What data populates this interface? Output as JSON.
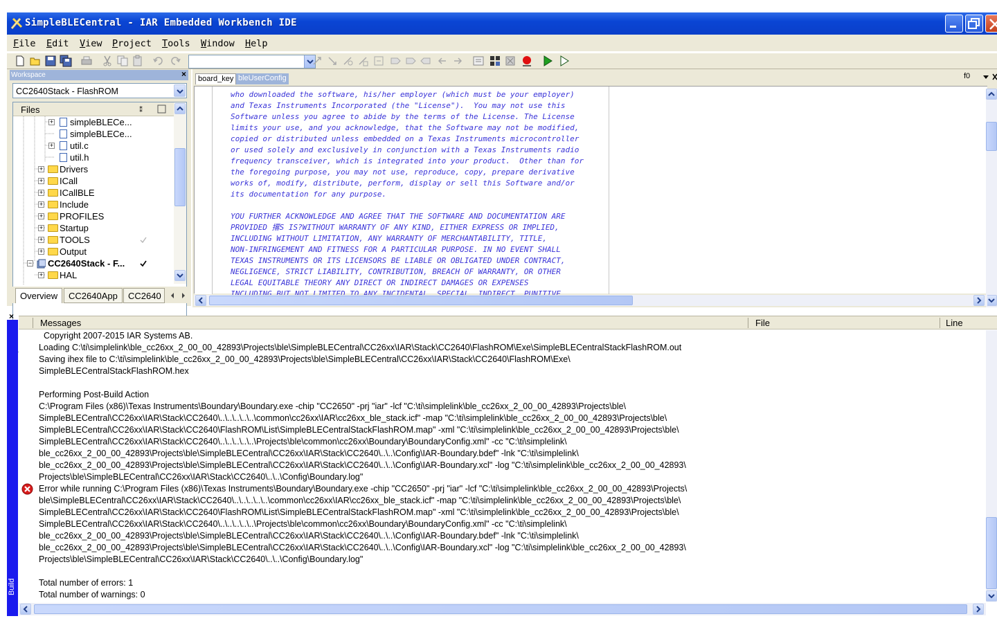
{
  "window": {
    "title": "SimpleBLECentral - IAR Embedded Workbench IDE"
  },
  "menu": [
    "File",
    "Edit",
    "View",
    "Project",
    "Tools",
    "Window",
    "Help"
  ],
  "workspace": {
    "header": "Workspace",
    "config": "CC2640Stack - FlashROM",
    "files_label": "Files",
    "tree": [
      {
        "label": "simpleBLECe...",
        "kind": "file-c"
      },
      {
        "label": "simpleBLECe...",
        "kind": "file-h"
      },
      {
        "label": "util.c",
        "kind": "file-c"
      },
      {
        "label": "util.h",
        "kind": "file-h"
      },
      {
        "label": "Drivers",
        "kind": "folder"
      },
      {
        "label": "ICall",
        "kind": "folder"
      },
      {
        "label": "ICallBLE",
        "kind": "folder"
      },
      {
        "label": "Include",
        "kind": "folder"
      },
      {
        "label": "PROFILES",
        "kind": "folder"
      },
      {
        "label": "Startup",
        "kind": "folder"
      },
      {
        "label": "TOOLS",
        "kind": "folder"
      },
      {
        "label": "Output",
        "kind": "folder"
      },
      {
        "label": "CC2640Stack - F...",
        "kind": "project"
      },
      {
        "label": "HAL",
        "kind": "folder"
      }
    ],
    "tabs": [
      "Overview",
      "CC2640App",
      "CC2640"
    ]
  },
  "editor": {
    "tabs": [
      "board_key",
      "bleUserConfig"
    ],
    "func_selector": "f0",
    "code_lines": [
      "who downloaded the software, his/her employer (which must be your employer)",
      "and Texas Instruments Incorporated (the \"License\").  You may not use this",
      "Software unless you agree to abide by the terms of the License. The License",
      "limits your use, and you acknowledge, that the Software may not be modified,",
      "copied or distributed unless embedded on a Texas Instruments microcontroller",
      "or used solely and exclusively in conjunction with a Texas Instruments radio",
      "frequency transceiver, which is integrated into your product.  Other than for",
      "the foregoing purpose, you may not use, reproduce, copy, prepare derivative",
      "works of, modify, distribute, perform, display or sell this Software and/or",
      "its documentation for any purpose.",
      "",
      "YOU FURTHER ACKNOWLEDGE AND AGREE THAT THE SOFTWARE AND DOCUMENTATION ARE",
      "PROVIDED 撂S IS?WITHOUT WARRANTY OF ANY KIND, EITHER EXPRESS OR IMPLIED,",
      "INCLUDING WITHOUT LIMITATION, ANY WARRANTY OF MERCHANTABILITY, TITLE,",
      "NON-INFRINGEMENT AND FITNESS FOR A PARTICULAR PURPOSE. IN NO EVENT SHALL",
      "TEXAS INSTRUMENTS OR ITS LICENSORS BE LIABLE OR OBLIGATED UNDER CONTRACT,",
      "NEGLIGENCE, STRICT LIABILITY, CONTRIBUTION, BREACH OF WARRANTY, OR OTHER",
      "LEGAL EQUITABLE THEORY ANY DIRECT OR INDIRECT DAMAGES OR EXPENSES",
      "INCLUDING BUT NOT LIMITED TO ANY INCIDENTAL, SPECIAL, INDIRECT, PUNITIVE"
    ]
  },
  "messages": {
    "columns": {
      "messages": "Messages",
      "file": "File",
      "line": "Line"
    },
    "side_label": "Build",
    "lines": [
      "  Copyright 2007-2015 IAR Systems AB.",
      "Loading C:\\ti\\simplelink\\ble_cc26xx_2_00_00_42893\\Projects\\ble\\SimpleBLECentral\\CC26xx\\IAR\\Stack\\CC2640\\FlashROM\\Exe\\SimpleBLECentralStackFlashROM.out",
      "Saving ihex file to C:\\ti\\simplelink\\ble_cc26xx_2_00_00_42893\\Projects\\ble\\SimpleBLECentral\\CC26xx\\IAR\\Stack\\CC2640\\FlashROM\\Exe\\",
      "SimpleBLECentralStackFlashROM.hex",
      "",
      "Performing Post-Build Action",
      "C:\\Program Files (x86)\\Texas Instruments\\Boundary\\Boundary.exe -chip \"CC2650\" -prj \"iar\" -lcf \"C:\\ti\\simplelink\\ble_cc26xx_2_00_00_42893\\Projects\\ble\\",
      "SimpleBLECentral\\CC26xx\\IAR\\Stack\\CC2640\\..\\..\\..\\..\\..\\common\\cc26xx\\IAR\\cc26xx_ble_stack.icf\" -map \"C:\\ti\\simplelink\\ble_cc26xx_2_00_00_42893\\Projects\\ble\\",
      "SimpleBLECentral\\CC26xx\\IAR\\Stack\\CC2640\\FlashROM\\List\\SimpleBLECentralStackFlashROM.map\" -xml \"C:\\ti\\simplelink\\ble_cc26xx_2_00_00_42893\\Projects\\ble\\",
      "SimpleBLECentral\\CC26xx\\IAR\\Stack\\CC2640\\..\\..\\..\\..\\..\\Projects\\ble\\common\\cc26xx\\Boundary\\BoundaryConfig.xml\" -cc \"C:\\ti\\simplelink\\",
      "ble_cc26xx_2_00_00_42893\\Projects\\ble\\SimpleBLECentral\\CC26xx\\IAR\\Stack\\CC2640\\..\\..\\Config\\IAR-Boundary.bdef\" -lnk \"C:\\ti\\simplelink\\",
      "ble_cc26xx_2_00_00_42893\\Projects\\ble\\SimpleBLECentral\\CC26xx\\IAR\\Stack\\CC2640\\..\\..\\Config\\IAR-Boundary.xcl\" -log \"C:\\ti\\simplelink\\ble_cc26xx_2_00_00_42893\\",
      "Projects\\ble\\SimpleBLECentral\\CC26xx\\IAR\\Stack\\CC2640\\..\\..\\Config\\Boundary.log\"",
      "Error while running C:\\Program Files (x86)\\Texas Instruments\\Boundary\\Boundary.exe -chip \"CC2650\" -prj \"iar\" -lcf \"C:\\ti\\simplelink\\ble_cc26xx_2_00_00_42893\\Projects\\",
      "ble\\SimpleBLECentral\\CC26xx\\IAR\\Stack\\CC2640\\..\\..\\..\\..\\..\\common\\cc26xx\\IAR\\cc26xx_ble_stack.icf\" -map \"C:\\ti\\simplelink\\ble_cc26xx_2_00_00_42893\\Projects\\ble\\",
      "SimpleBLECentral\\CC26xx\\IAR\\Stack\\CC2640\\FlashROM\\List\\SimpleBLECentralStackFlashROM.map\" -xml \"C:\\ti\\simplelink\\ble_cc26xx_2_00_00_42893\\Projects\\ble\\",
      "SimpleBLECentral\\CC26xx\\IAR\\Stack\\CC2640\\..\\..\\..\\..\\..\\Projects\\ble\\common\\cc26xx\\Boundary\\BoundaryConfig.xml\" -cc \"C:\\ti\\simplelink\\",
      "ble_cc26xx_2_00_00_42893\\Projects\\ble\\SimpleBLECentral\\CC26xx\\IAR\\Stack\\CC2640\\..\\..\\Config\\IAR-Boundary.bdef\" -lnk \"C:\\ti\\simplelink\\",
      "ble_cc26xx_2_00_00_42893\\Projects\\ble\\SimpleBLECentral\\CC26xx\\IAR\\Stack\\CC2640\\..\\..\\Config\\IAR-Boundary.xcl\" -log \"C:\\ti\\simplelink\\ble_cc26xx_2_00_00_42893\\",
      "Projects\\ble\\SimpleBLECentral\\CC26xx\\IAR\\Stack\\CC2640\\..\\..\\Config\\Boundary.log\"",
      "",
      "Total number of errors: 1",
      "Total number of warnings: 0"
    ]
  },
  "colors": {
    "titlebar": "#0a45d4",
    "code_comment": "#3a34d8",
    "error": "#d81c1c",
    "folder": "#ffd84a",
    "build_side": "#1a1aee"
  }
}
